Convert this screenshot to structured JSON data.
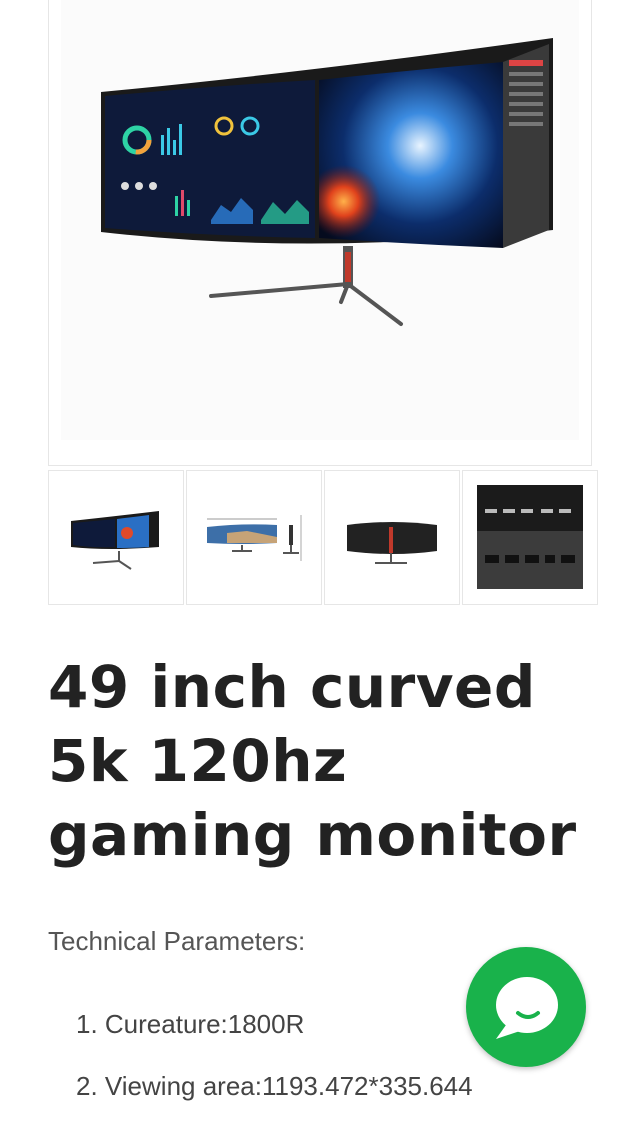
{
  "product": {
    "title": "49 inch curved 5k 120hz gaming monitor",
    "params_heading": "Technical Parameters:",
    "params": [
      "1. Cureature:1800R",
      "2. Viewing area:1193.472*335.644"
    ]
  },
  "gallery": {
    "main_image": "curved-monitor-dashboard-and-earth-photo",
    "thumbnails": [
      "curved-monitor-front",
      "monitor-dimension-drawing",
      "monitor-rear-view",
      "monitor-ports-closeup"
    ]
  },
  "chat": {
    "icon": "chat-bubble-icon",
    "color": "#19b24b"
  }
}
